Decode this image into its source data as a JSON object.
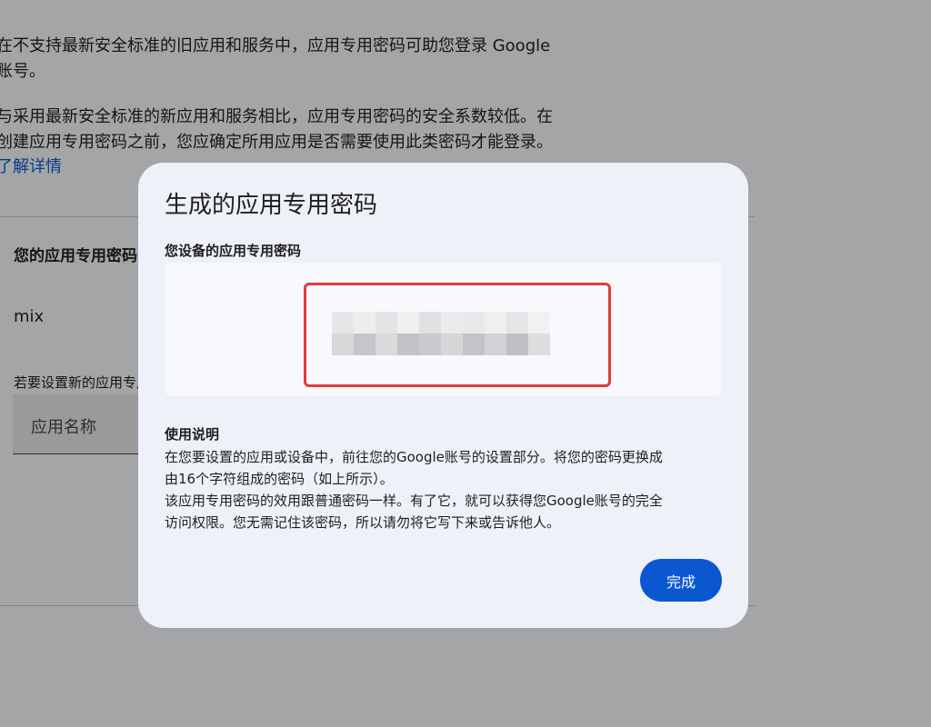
{
  "background": {
    "intro_line1": "在不支持最新安全标准的旧应用和服务中，应用专用密码可助您登录 Google",
    "intro_line2": "账号。",
    "warning_line1": "与采用最新安全标准的新应用和服务相比，应用专用密码的安全系数较低。在",
    "warning_line2": "创建应用专用密码之前，您应确定所用应用是否需要使用此类密码才能登录。",
    "learn_more_link": "了解详情",
    "section_title": "您的应用专用密码",
    "existing_app_name": "mix",
    "new_password_hint": "若要设置新的应用专用密码，请在下方输入应用名称。",
    "app_name_placeholder": "应用名称"
  },
  "dialog": {
    "title": "生成的应用专用密码",
    "password_label": "您设备的应用专用密码",
    "password_value": "",
    "usage_title": "使用说明",
    "usage_line1": "在您要设置的应用或设备中，前往您的Google账号的设置部分。将您的密码更换成",
    "usage_line2": "由16个字符组成的密码（如上所示）。",
    "usage_line3": "该应用专用密码的效用跟普通密码一样。有了它，就可以获得您Google账号的完全",
    "usage_line4": "访问权限。您无需记住该密码，所以请勿将它写下来或告诉他人。",
    "done_label": "完成"
  },
  "colors": {
    "accent": "#0b57d0",
    "highlight": "#e03c3c",
    "dialog_bg": "#eef1f8"
  }
}
